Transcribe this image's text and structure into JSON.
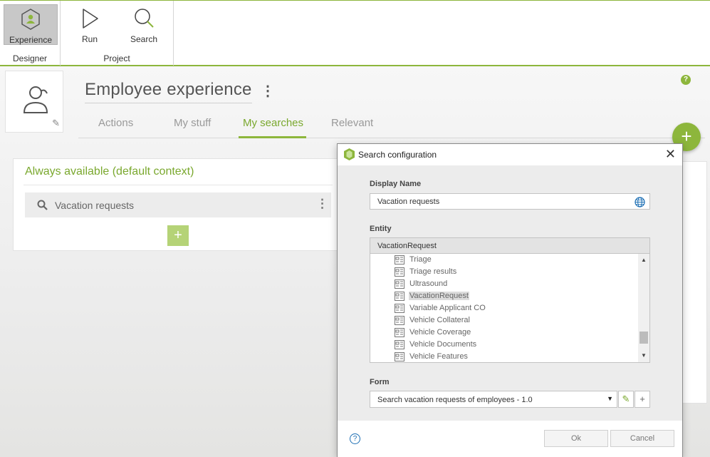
{
  "ribbon": {
    "groups": [
      {
        "label": "Designer",
        "buttons": [
          {
            "label": "Experience",
            "icon": "experience-icon",
            "active": true
          }
        ]
      },
      {
        "label": "Project",
        "buttons": [
          {
            "label": "Run",
            "icon": "play-icon"
          },
          {
            "label": "Search",
            "icon": "search-icon"
          }
        ]
      }
    ]
  },
  "header": {
    "help_glyph": "?",
    "title": "Employee experience",
    "menu_glyph": "⋮"
  },
  "tabs": [
    {
      "label": "Actions",
      "active": false
    },
    {
      "label": "My stuff",
      "active": false
    },
    {
      "label": "My searches",
      "active": true
    },
    {
      "label": "Relevant",
      "active": false
    }
  ],
  "fab": {
    "glyph": "+"
  },
  "context_card": {
    "title": "Always available (default context)",
    "search_item": "Vacation requests",
    "menu_glyph": "⋮",
    "add_glyph": "+"
  },
  "dialog": {
    "title": "Search configuration",
    "close_glyph": "✕",
    "display_name": {
      "label": "Display Name",
      "value": "Vacation requests"
    },
    "entity": {
      "label": "Entity",
      "selected": "VacationRequest",
      "items": [
        {
          "name": "Triage",
          "selected": false
        },
        {
          "name": "Triage results",
          "selected": false
        },
        {
          "name": "Ultrasound",
          "selected": false
        },
        {
          "name": "VacationRequest",
          "selected": true
        },
        {
          "name": "Variable Applicant CO",
          "selected": false
        },
        {
          "name": "Vehicle Collateral",
          "selected": false
        },
        {
          "name": "Vehicle Coverage",
          "selected": false
        },
        {
          "name": "Vehicle Documents",
          "selected": false
        },
        {
          "name": "Vehicle Features",
          "selected": false
        }
      ]
    },
    "form": {
      "label": "Form",
      "value": "Search vacation requests of employees - 1.0",
      "caret_glyph": "▼",
      "edit_glyph": "✎",
      "add_glyph": "+"
    },
    "footer": {
      "help_glyph": "?",
      "ok_label": "Ok",
      "cancel_label": "Cancel"
    }
  },
  "colors": {
    "accent": "#8db63c",
    "accent_text": "#7aa82e",
    "link_blue": "#1a6db3"
  }
}
